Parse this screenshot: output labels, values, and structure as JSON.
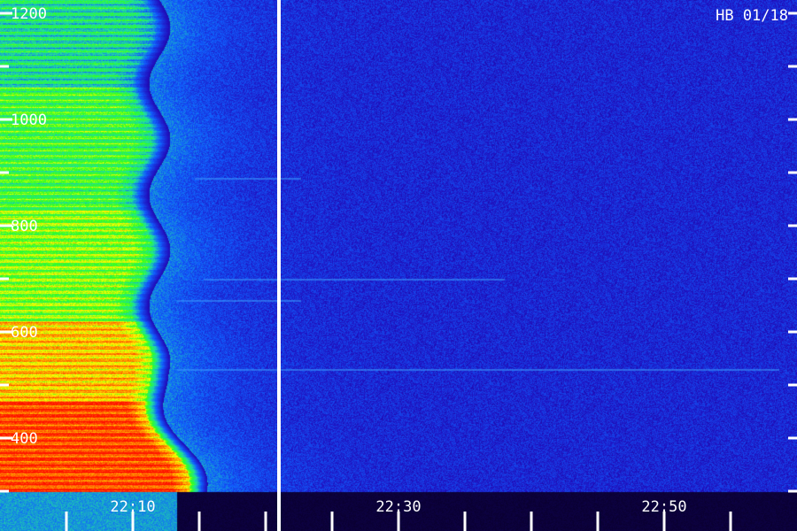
{
  "chart_data": {
    "type": "heatmap",
    "title": "HB 01/18",
    "xlabel": "",
    "ylabel": "",
    "x_ticks": [
      "22:10",
      "22:30",
      "22:50"
    ],
    "y_ticks": [
      400,
      600,
      800,
      1000,
      1200
    ],
    "y_range": [
      270,
      1240
    ],
    "x_range": [
      "22:08",
      "22:58"
    ],
    "marker_time": "22:21",
    "emission_bands": [
      {
        "freq_low": 290,
        "freq_high": 470,
        "intensity": 0.93
      },
      {
        "freq_low": 470,
        "freq_high": 620,
        "intensity": 0.78
      },
      {
        "freq_low": 620,
        "freq_high": 830,
        "intensity": 0.62
      },
      {
        "freq_low": 830,
        "freq_high": 1060,
        "intensity": 0.55
      },
      {
        "freq_low": 1060,
        "freq_high": 1240,
        "intensity": 0.45
      }
    ],
    "emission_end_time": "22:12",
    "colormap": [
      "#0a0030",
      "#2010c0",
      "#1060ff",
      "#20e0a0",
      "#30ff20",
      "#ffff00",
      "#ff8000",
      "#ff1000"
    ],
    "colors": {
      "background": "#040010",
      "axis": "#ffffff"
    }
  }
}
